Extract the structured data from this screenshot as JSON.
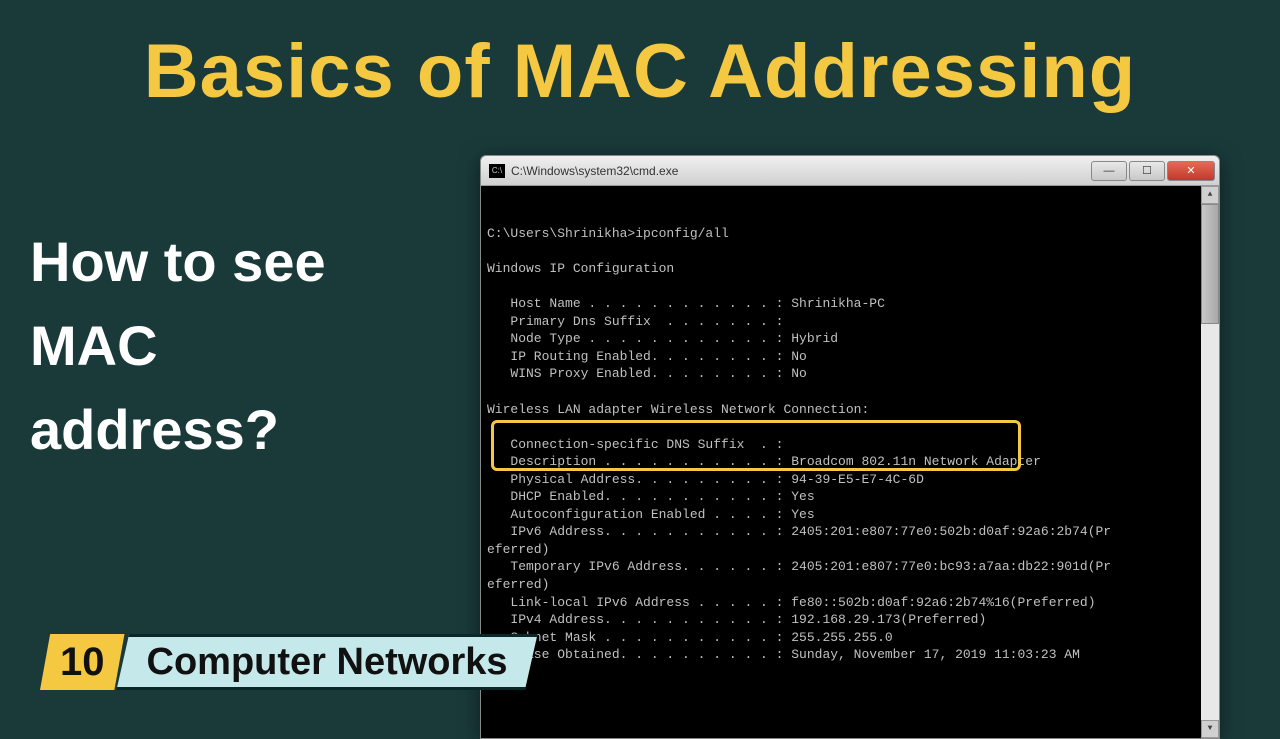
{
  "title": "Basics of MAC Addressing",
  "subtitle_lines": [
    "How to see",
    "MAC",
    "address?"
  ],
  "footer": {
    "number": "10",
    "label": "Computer Networks"
  },
  "cmd": {
    "icon_text": "C:\\",
    "title": "C:\\Windows\\system32\\cmd.exe",
    "prompt": "C:\\Users\\Shrinikha>ipconfig/all",
    "section1_title": "Windows IP Configuration",
    "kv1": [
      [
        "Host Name . . . . . . . . . . . . :",
        "Shrinikha-PC"
      ],
      [
        "Primary Dns Suffix  . . . . . . . :",
        ""
      ],
      [
        "Node Type . . . . . . . . . . . . :",
        "Hybrid"
      ],
      [
        "IP Routing Enabled. . . . . . . . :",
        "No"
      ],
      [
        "WINS Proxy Enabled. . . . . . . . :",
        "No"
      ]
    ],
    "section2_title": "Wireless LAN adapter Wireless Network Connection:",
    "kv2_pre": [
      [
        "Connection-specific DNS Suffix  . :",
        ""
      ],
      [
        "Description . . . . . . . . . . . :",
        "Broadcom 802.11n Network Adapter"
      ]
    ],
    "highlighted": [
      "Physical Address. . . . . . . . . :",
      "94-39-E5-E7-4C-6D"
    ],
    "kv2_post": [
      [
        "DHCP Enabled. . . . . . . . . . . :",
        "Yes"
      ],
      [
        "Autoconfiguration Enabled . . . . :",
        "Yes"
      ],
      [
        "IPv6 Address. . . . . . . . . . . :",
        "2405:201:e807:77e0:502b:d0af:92a6:2b74(Pr"
      ],
      [
        "eferred)",
        ""
      ],
      [
        "Temporary IPv6 Address. . . . . . :",
        "2405:201:e807:77e0:bc93:a7aa:db22:901d(Pr"
      ],
      [
        "eferred)",
        ""
      ],
      [
        "Link-local IPv6 Address . . . . . :",
        "fe80::502b:d0af:92a6:2b74%16(Preferred)"
      ],
      [
        "IPv4 Address. . . . . . . . . . . :",
        "192.168.29.173(Preferred)"
      ],
      [
        "Subnet Mask . . . . . . . . . . . :",
        "255.255.255.0"
      ],
      [
        "Lease Obtained. . . . . . . . . . :",
        "Sunday, November 17, 2019 11:03:23 AM"
      ]
    ]
  }
}
